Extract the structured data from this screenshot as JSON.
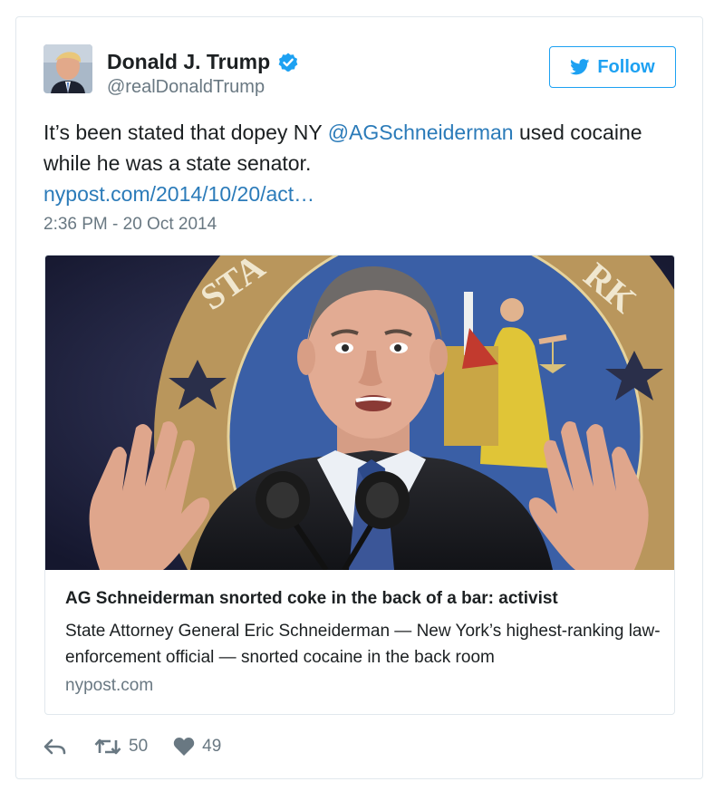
{
  "user": {
    "name": "Donald J. Trump",
    "handle": "@realDonaldTrump"
  },
  "follow": {
    "label": "Follow"
  },
  "tweet": {
    "text_before": "It’s been stated that dopey NY ",
    "mention": "@AGSchneiderman",
    "text_after": " used cocaine while he was a state senator.",
    "link": "nypost.com/2014/10/20/act…",
    "timestamp": "2:36 PM - 20 Oct 2014"
  },
  "card": {
    "title": "AG Schneiderman snorted coke in the back of a bar: activist",
    "description": "State Attorney General Eric Schneiderman — New York’s highest-ranking law-enforcement official — snorted cocaine in the back room",
    "domain": "nypost.com",
    "seal_text_left": "STA",
    "seal_text_right": "RK"
  },
  "actions": {
    "retweets": "50",
    "likes": "49"
  },
  "colors": {
    "link": "#2b7bb9",
    "twitter_blue": "#1da1f2",
    "muted": "#697882",
    "border": "#e1e8ed"
  },
  "icons": {
    "verified": "verified-badge-icon",
    "bird": "twitter-bird-icon",
    "reply": "reply-icon",
    "retweet": "retweet-icon",
    "like": "heart-icon"
  }
}
